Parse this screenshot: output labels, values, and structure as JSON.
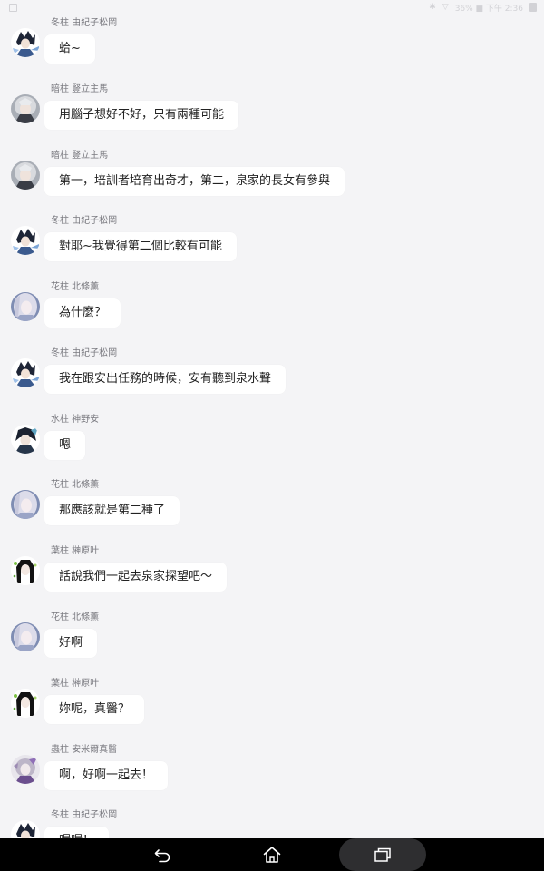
{
  "status_bar": {
    "text": "36% ■ 下午 2:36"
  },
  "colors": {
    "background": "#f4f4f6",
    "bubble": "#ffffff",
    "sender_text": "#7a7a80",
    "message_text": "#222222",
    "nav_bar": "#000000"
  },
  "messages": [
    {
      "sender": "冬柱 由紀子松岡",
      "text": "蛤~",
      "avatar": "toki-avatar"
    },
    {
      "sender": "暗柱 豎立主馬",
      "text": "用腦子想好不好，只有兩種可能",
      "avatar": "kurai-avatar"
    },
    {
      "sender": "暗柱 豎立主馬",
      "text": "第一，培訓者培育出奇才，第二，泉家的長女有參與",
      "avatar": "kurai-avatar"
    },
    {
      "sender": "冬柱 由紀子松岡",
      "text": "對耶~我覺得第二個比較有可能",
      "avatar": "toki-avatar"
    },
    {
      "sender": "花柱 北條薰",
      "text": "為什麼？",
      "avatar": "hana-avatar"
    },
    {
      "sender": "冬柱 由紀子松岡",
      "text": "我在跟安出任務的時候，安有聽到泉水聲",
      "avatar": "toki-avatar"
    },
    {
      "sender": "水柱 神野安",
      "text": "嗯",
      "avatar": "mizu-avatar"
    },
    {
      "sender": "花柱 北條薰",
      "text": "那應該就是第二種了",
      "avatar": "hana-avatar"
    },
    {
      "sender": "葉柱 榊原叶",
      "text": "話說我們一起去泉家探望吧〜",
      "avatar": "ha-avatar"
    },
    {
      "sender": "花柱 北條薰",
      "text": "好啊",
      "avatar": "hana-avatar"
    },
    {
      "sender": "葉柱 榊原叶",
      "text": "妳呢，真醫？",
      "avatar": "ha-avatar"
    },
    {
      "sender": "蟲柱 安米爾真醫",
      "text": "啊，好啊一起去！",
      "avatar": "mushi-avatar"
    },
    {
      "sender": "冬柱 由紀子松岡",
      "text": "喔喔！",
      "avatar": "toki-avatar"
    }
  ],
  "nav": {
    "back": "back-icon",
    "home": "home-icon",
    "recents": "recents-icon"
  }
}
